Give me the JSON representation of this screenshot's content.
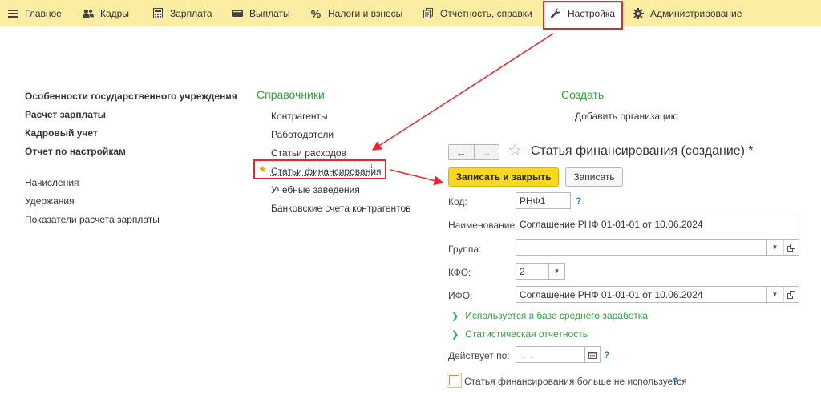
{
  "menu": {
    "tabs": [
      {
        "label": "Главное",
        "icon": "menu-lines-icon"
      },
      {
        "label": "Кадры",
        "icon": "people-icon"
      },
      {
        "label": "Зарплата",
        "icon": "calculator-icon"
      },
      {
        "label": "Выплаты",
        "icon": "wallet-icon"
      },
      {
        "label": "Налоги и взносы",
        "icon": "percent-icon"
      },
      {
        "label": "Отчетность, справки",
        "icon": "documents-icon"
      },
      {
        "label": "Настройка",
        "icon": "wrench-icon"
      },
      {
        "label": "Администрирование",
        "icon": "gear-icon"
      }
    ],
    "active": "Настройка"
  },
  "left": {
    "bold_items": [
      "Особенности государственного учреждения",
      "Расчет зарплаты",
      "Кадровый учет",
      "Отчет по настройкам"
    ],
    "plain_items": [
      "Начисления",
      "Удержания",
      "Показатели расчета зарплаты"
    ]
  },
  "references": {
    "title": "Справочники",
    "items": [
      "Контрагенты",
      "Работодатели",
      "Статьи расходов",
      "Статьи финансирования",
      "Учебные заведения",
      "Банковские счета контрагентов"
    ]
  },
  "create": {
    "title": "Создать",
    "items": [
      "Добавить организацию"
    ]
  },
  "form": {
    "title": "Статья финансирования (создание) *",
    "nav": {
      "back": "←",
      "forward": "→"
    },
    "save_close": "Записать и закрыть",
    "save": "Записать",
    "fields": {
      "code": {
        "label": "Код:",
        "value": "РНФ1"
      },
      "name": {
        "label": "Наименование:",
        "value": "Соглашение РНФ 01-01-01 от 10.06.2024"
      },
      "group": {
        "label": "Группа:",
        "value": ""
      },
      "kfo": {
        "label": "КФО:",
        "value": "2"
      },
      "ifo": {
        "label": "ИФО:",
        "value": "Соглашение РНФ 01-01-01 от 10.06.2024"
      },
      "valid": {
        "label": "Действует по:",
        "value": " .  ."
      }
    },
    "help": "?",
    "expanders": [
      "Используется в базе среднего заработка",
      "Статистическая отчетность"
    ],
    "checkbox_label": "Статья финансирования больше не используется"
  },
  "colors": {
    "accent": "#2aa53b",
    "menu_bg": "#fbeda2",
    "primary_button": "#fbd81c",
    "annotation": "#e8262d"
  }
}
